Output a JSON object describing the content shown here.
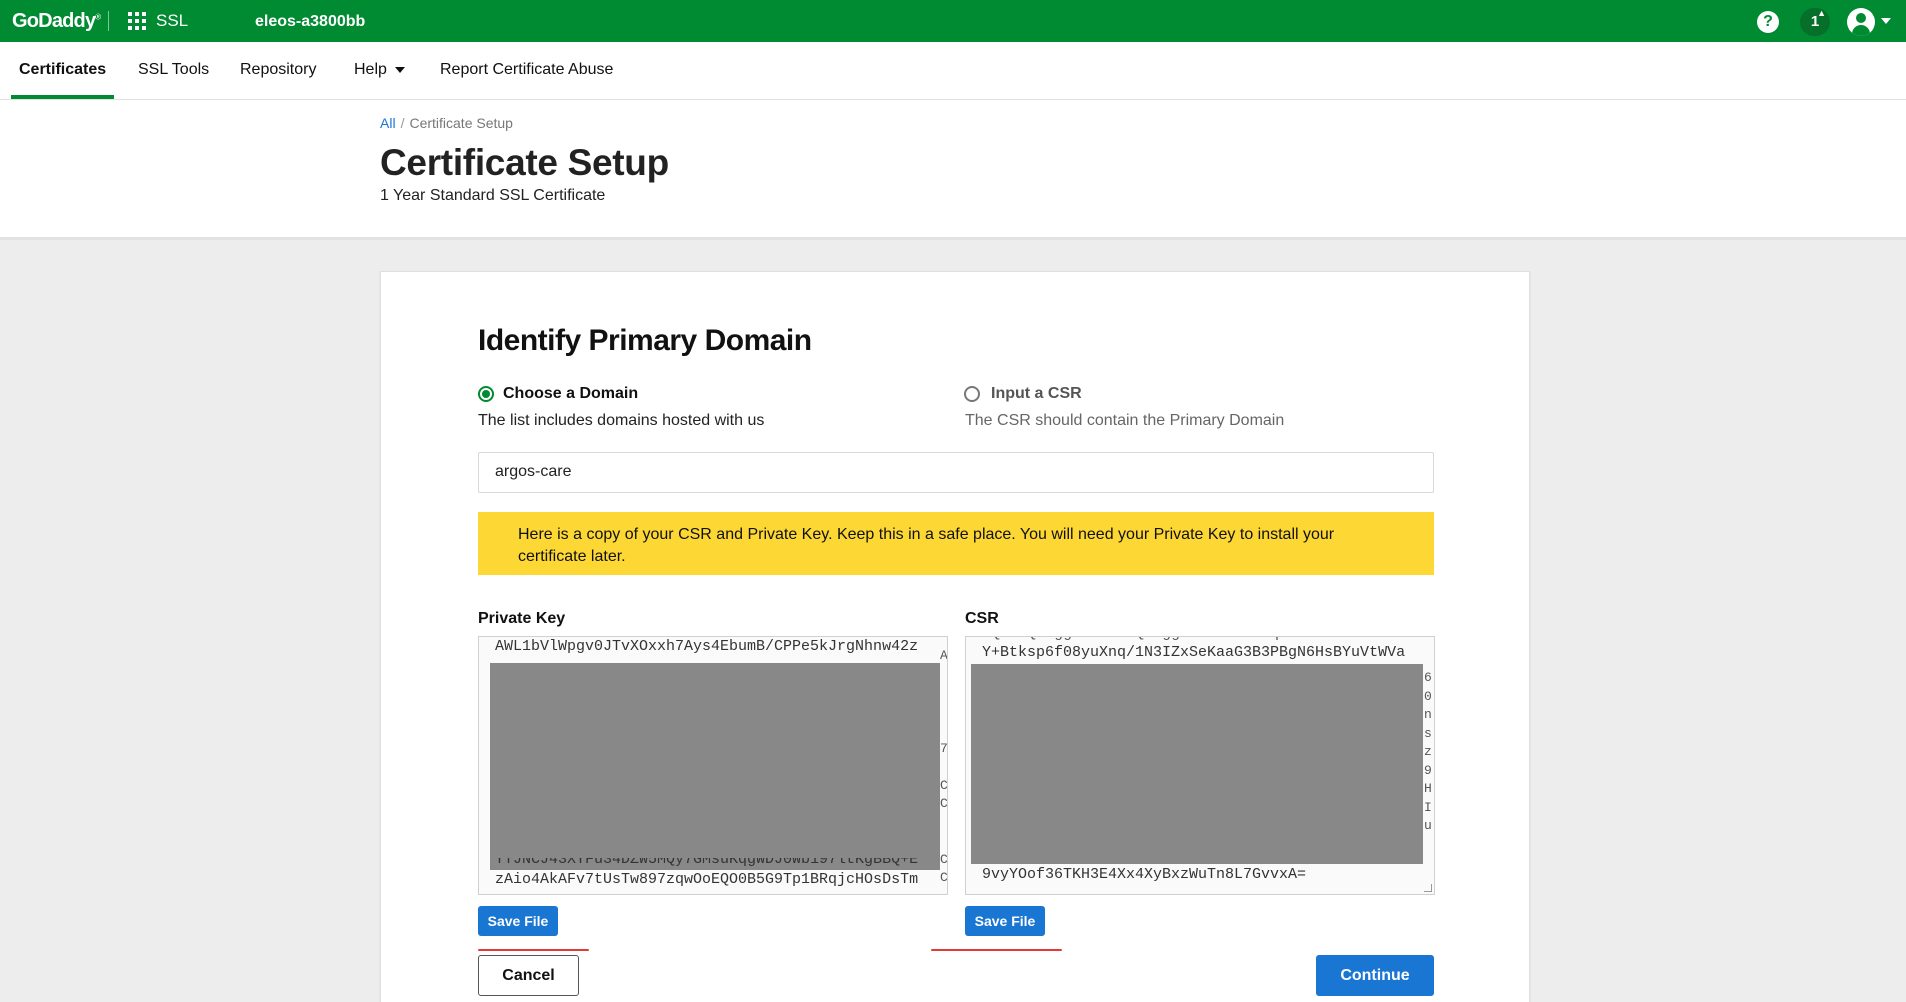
{
  "topbar": {
    "logo": "GoDaddy",
    "product": "SSL",
    "account": "eleos-a3800bb",
    "notification_count": "1",
    "brand_color": "#008a32",
    "icons": [
      "apps-grid-icon",
      "help-icon",
      "bell-icon",
      "user-avatar-icon",
      "chevron-down-icon"
    ]
  },
  "nav": {
    "items": [
      {
        "label": "Certificates",
        "active": true
      },
      {
        "label": "SSL Tools"
      },
      {
        "label": "Repository"
      },
      {
        "label": "Help"
      },
      {
        "label": "Report Certificate Abuse"
      }
    ]
  },
  "breadcrumb": {
    "root": "All",
    "separator": "/",
    "current": "Certificate Setup"
  },
  "page": {
    "title": "Certificate Setup",
    "subtitle": "1 Year Standard SSL Certificate"
  },
  "form": {
    "section_title": "Identify Primary Domain",
    "options": [
      {
        "label": "Choose a Domain",
        "description": "The list includes domains hosted with us",
        "selected": true
      },
      {
        "label": "Input a CSR",
        "description": "The CSR should contain the Primary Domain",
        "selected": false
      }
    ],
    "domain_value": "argos-care",
    "alert": "Here is a copy of your CSR and Private Key. Keep this in a safe place. You will need your Private Key to install your certificate later.",
    "alert_color": "#fdd835",
    "private_key": {
      "label": "Private Key",
      "first_line": "AWL1bVlWpgv0JTvXOxxh7Ays4EbumB/CPPe5kJrgNhnw42z",
      "partial_line": "YTJNCJ43XYFu34DZW5MQy7GMsuKqgWDJ0Wb197ltKgBBQ+E",
      "last_line": "zAio4AkAFv7tUsTw897zqwOoEQO0B5G9Tp1BRqjcHOsDsTm",
      "edge_chars": [
        "A",
        "",
        "",
        "",
        "",
        "7",
        "",
        "C",
        "C",
        "",
        "",
        "C",
        "C"
      ],
      "save_label": "Save File"
    },
    "csr": {
      "label": "CSR",
      "first_line": "Y+Btksp6f08yuXnq/1N3IZxSeKaaG3B3PBgN6HsBYuVtWVa",
      "last_line": "9vyYOof36TKH3E4Xx4XyBxzWuTn8L7GvvxA=",
      "edge_chars": [
        "6",
        "0",
        "n",
        "s",
        "z",
        "9",
        "H",
        "I",
        "u"
      ],
      "save_label": "Save File"
    },
    "cancel_label": "Cancel",
    "continue_label": "Continue",
    "accent_color": "#1976d2",
    "annotation_color": "#e53935"
  }
}
